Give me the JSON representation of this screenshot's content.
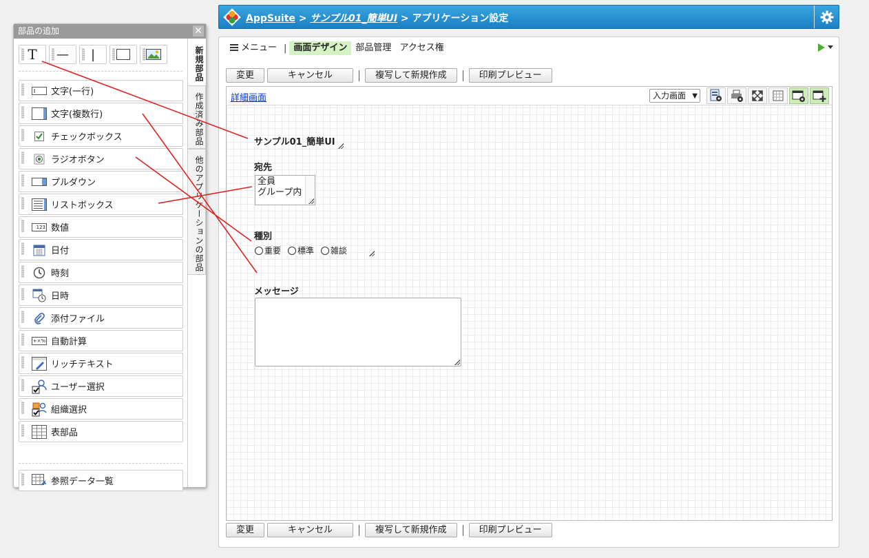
{
  "header": {
    "app": "AppSuite",
    "sep1": " > ",
    "app_name": "サンプル01_簡単UI",
    "sep2": " > ",
    "page": "アプリケーション設定"
  },
  "tabs": [
    {
      "label": "メニュー"
    },
    {
      "label": "画面デザイン"
    },
    {
      "label": "部品管理"
    },
    {
      "label": "アクセス権"
    }
  ],
  "tab_separator": "|",
  "buttons": {
    "change": "変更",
    "cancel": "キャンセル",
    "copy_new": "複写して新規作成",
    "print_preview": "印刷プレビュー",
    "separator": "|"
  },
  "canvas": {
    "detail_link": "詳細画面",
    "view_select": "入力画面",
    "title_field": "サンプル01_簡単UI",
    "dest_label": "宛先",
    "dest_options": [
      "全員",
      "グループ内"
    ],
    "type_label": "種別",
    "type_options": [
      "重要",
      "標準",
      "雑談"
    ],
    "message_label": "メッセージ"
  },
  "palette": {
    "title": "部品の追加",
    "close": "✕",
    "vertical_tabs": [
      "新規部品",
      "作成済み部品",
      "他のアプリケーションの部品"
    ],
    "items": [
      {
        "label": "文字(一行)",
        "icon": "single-line-text-icon"
      },
      {
        "label": "文字(複数行)",
        "icon": "multi-line-text-icon"
      },
      {
        "label": "チェックボックス",
        "icon": "checkbox-icon"
      },
      {
        "label": "ラジオボタン",
        "icon": "radio-icon"
      },
      {
        "label": "プルダウン",
        "icon": "dropdown-icon"
      },
      {
        "label": "リストボックス",
        "icon": "listbox-icon"
      },
      {
        "label": "数値",
        "icon": "number-icon"
      },
      {
        "label": "日付",
        "icon": "calendar-icon"
      },
      {
        "label": "時刻",
        "icon": "clock-icon"
      },
      {
        "label": "日時",
        "icon": "datetime-icon"
      },
      {
        "label": "添付ファイル",
        "icon": "paperclip-icon"
      },
      {
        "label": "自動計算",
        "icon": "calc-icon"
      },
      {
        "label": "リッチテキスト",
        "icon": "richtext-icon"
      },
      {
        "label": "ユーザー選択",
        "icon": "user-select-icon"
      },
      {
        "label": "組織選択",
        "icon": "org-select-icon"
      },
      {
        "label": "表部品",
        "icon": "table-icon"
      }
    ],
    "extra_item": {
      "label": "参照データ一覧",
      "icon": "reference-list-icon"
    },
    "quick_icons": {
      "text": "T",
      "hline": "—",
      "vline": "|"
    },
    "number_icon_text": "123",
    "calc_icon_text": "+×%"
  },
  "colors": {
    "header_blue": "#2b8fd0",
    "active_tab_green": "#d4f2c4",
    "link_blue": "#0033cc",
    "annotation_red": "#e02020"
  }
}
